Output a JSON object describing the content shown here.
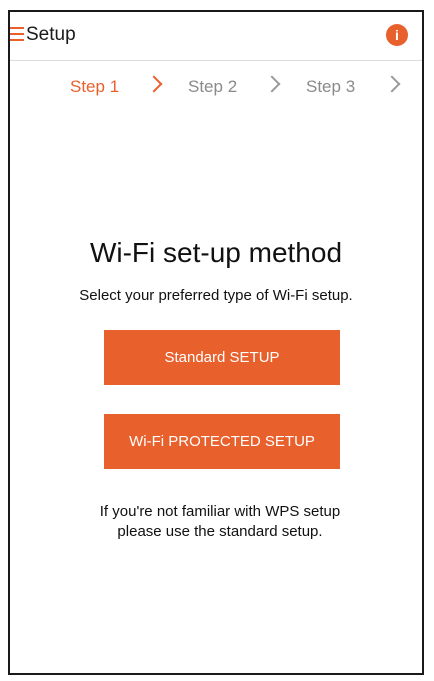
{
  "header": {
    "title": "Setup",
    "menu_icon": "hamburger-menu-icon",
    "info_icon": "info-icon",
    "info_glyph": "i"
  },
  "steps": [
    {
      "label": "Step 1",
      "active": true
    },
    {
      "label": "Step 2",
      "active": false
    },
    {
      "label": "Step 3",
      "active": false
    }
  ],
  "main": {
    "heading": "Wi-Fi set-up method",
    "subtitle": "Select your preferred type of Wi-Fi setup.",
    "standard_button": "Standard SETUP",
    "wps_button": "Wi-Fi PROTECTED SETUP",
    "note": "If you're not familiar with WPS setup please use the standard setup."
  },
  "colors": {
    "accent": "#e8602c",
    "inactive_step": "#8a8a8a"
  }
}
